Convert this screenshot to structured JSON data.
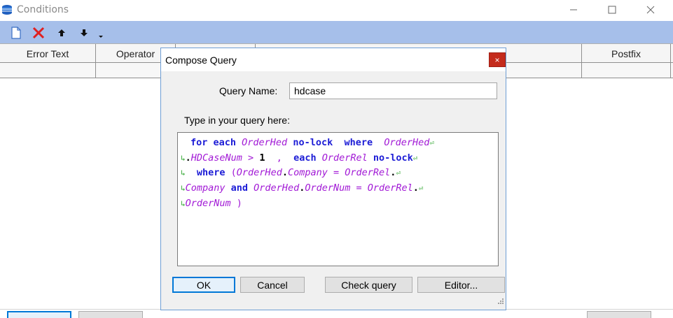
{
  "window": {
    "title": "Conditions"
  },
  "toolbar": {
    "items": [
      "new-icon",
      "delete-icon",
      "move-up-icon",
      "move-down-icon",
      "overflow-icon"
    ],
    "accent": "#a6bfea"
  },
  "grid": {
    "columns": [
      {
        "label": "Error Text"
      },
      {
        "label": "Operator"
      },
      {
        "label": ""
      },
      {
        "label": ""
      },
      {
        "label": "Postfix"
      }
    ]
  },
  "dialog": {
    "title": "Compose Query",
    "close_glyph": "×",
    "query_name_label": "Query Name:",
    "query_name_value": "hdcase",
    "query_prompt": "Type in your query here:",
    "buttons": {
      "ok": "OK",
      "cancel": "Cancel",
      "check": "Check query",
      "editor": "Editor..."
    }
  },
  "query": {
    "l1a": "for each ",
    "l1b": "OrderHed",
    "l1c": " no-lock  ",
    "l1d": "where  ",
    "l1e": "OrderHed",
    "l2a": ".",
    "l2b": "HDCaseNum",
    "l2c": " > ",
    "l2d": "1",
    "l2e": "  , ",
    "l2f": " each ",
    "l2g": "OrderRel",
    "l2h": " no-lock",
    "l3a": "  where ",
    "l3b": "(",
    "l3c": "OrderHed",
    "l3d": ".",
    "l3e": "Company",
    "l3f": " = ",
    "l3g": "OrderRel",
    "l3h": ".",
    "l4a": "Company",
    "l4b": " and ",
    "l4c": "OrderHed",
    "l4d": ".",
    "l4e": "OrderNum",
    "l4f": " = ",
    "l4g": "OrderRel",
    "l4h": ".",
    "l5a": "OrderNum",
    "l5b": " )",
    "wrap_end": "⏎",
    "wrap_start": "↳"
  },
  "colors": {
    "keyword": "#1c1cd6",
    "table": "#a21ad6",
    "close": "#c42b1c",
    "focus": "#0078d7"
  }
}
